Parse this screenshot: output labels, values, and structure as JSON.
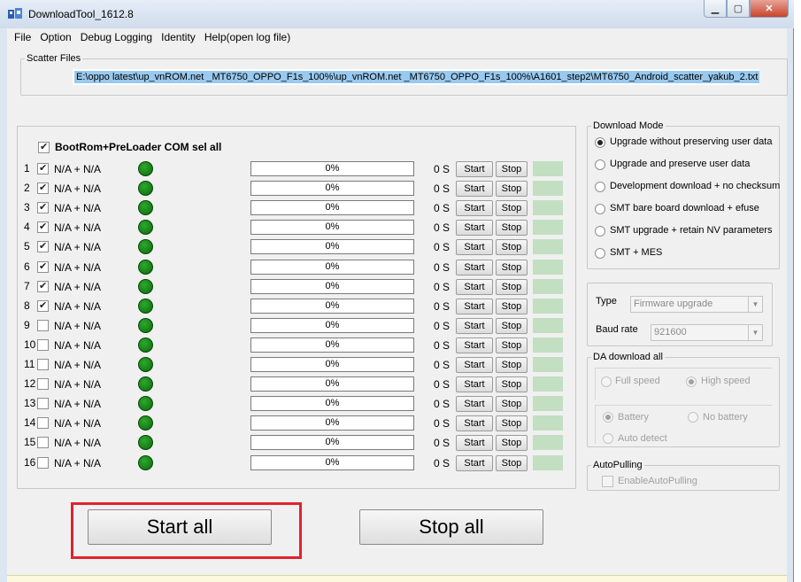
{
  "window": {
    "title": "DownloadTool_1612.8"
  },
  "menu": [
    "File",
    "Option",
    "Debug Logging",
    "Identity",
    "Help(open log file)"
  ],
  "scatter": {
    "legend": "Scatter Files",
    "path": "E:\\oppo latest\\up_vnROM.net _MT6750_OPPO_F1s_100%\\up_vnROM.net _MT6750_OPPO_F1s_100%\\A1601_step2\\MT6750_Android_scatter_yakub_2.txt"
  },
  "ports": {
    "select_all_label": "BootRom+PreLoader COM sel all",
    "select_all_checked": true,
    "rows": [
      {
        "num": "1",
        "checked": true,
        "label": "N/A + N/A",
        "progress": "0%",
        "time": "0 S",
        "start": "Start",
        "stop": "Stop"
      },
      {
        "num": "2",
        "checked": true,
        "label": "N/A + N/A",
        "progress": "0%",
        "time": "0 S",
        "start": "Start",
        "stop": "Stop"
      },
      {
        "num": "3",
        "checked": true,
        "label": "N/A + N/A",
        "progress": "0%",
        "time": "0 S",
        "start": "Start",
        "stop": "Stop"
      },
      {
        "num": "4",
        "checked": true,
        "label": "N/A + N/A",
        "progress": "0%",
        "time": "0 S",
        "start": "Start",
        "stop": "Stop"
      },
      {
        "num": "5",
        "checked": true,
        "label": "N/A + N/A",
        "progress": "0%",
        "time": "0 S",
        "start": "Start",
        "stop": "Stop"
      },
      {
        "num": "6",
        "checked": true,
        "label": "N/A + N/A",
        "progress": "0%",
        "time": "0 S",
        "start": "Start",
        "stop": "Stop"
      },
      {
        "num": "7",
        "checked": true,
        "label": "N/A + N/A",
        "progress": "0%",
        "time": "0 S",
        "start": "Start",
        "stop": "Stop"
      },
      {
        "num": "8",
        "checked": true,
        "label": "N/A + N/A",
        "progress": "0%",
        "time": "0 S",
        "start": "Start",
        "stop": "Stop"
      },
      {
        "num": "9",
        "checked": false,
        "label": "N/A + N/A",
        "progress": "0%",
        "time": "0 S",
        "start": "Start",
        "stop": "Stop"
      },
      {
        "num": "10",
        "checked": false,
        "label": "N/A + N/A",
        "progress": "0%",
        "time": "0 S",
        "start": "Start",
        "stop": "Stop"
      },
      {
        "num": "11",
        "checked": false,
        "label": "N/A + N/A",
        "progress": "0%",
        "time": "0 S",
        "start": "Start",
        "stop": "Stop"
      },
      {
        "num": "12",
        "checked": false,
        "label": "N/A + N/A",
        "progress": "0%",
        "time": "0 S",
        "start": "Start",
        "stop": "Stop"
      },
      {
        "num": "13",
        "checked": false,
        "label": "N/A + N/A",
        "progress": "0%",
        "time": "0 S",
        "start": "Start",
        "stop": "Stop"
      },
      {
        "num": "14",
        "checked": false,
        "label": "N/A + N/A",
        "progress": "0%",
        "time": "0 S",
        "start": "Start",
        "stop": "Stop"
      },
      {
        "num": "15",
        "checked": false,
        "label": "N/A + N/A",
        "progress": "0%",
        "time": "0 S",
        "start": "Start",
        "stop": "Stop"
      },
      {
        "num": "16",
        "checked": false,
        "label": "N/A + N/A",
        "progress": "0%",
        "time": "0 S",
        "start": "Start",
        "stop": "Stop"
      }
    ]
  },
  "download_mode": {
    "legend": "Download Mode",
    "options": [
      {
        "label": "Upgrade without preserving user data",
        "selected": true
      },
      {
        "label": "Upgrade and preserve user data",
        "selected": false
      },
      {
        "label": "Development download + no checksum",
        "selected": false
      },
      {
        "label": "SMT bare board download + efuse",
        "selected": false
      },
      {
        "label": "SMT upgrade + retain NV parameters",
        "selected": false
      },
      {
        "label": "SMT + MES",
        "selected": false
      }
    ]
  },
  "settings": {
    "type_label": "Type",
    "type_value": "Firmware upgrade",
    "baud_label": "Baud rate",
    "baud_value": "921600"
  },
  "da_download": {
    "legend": "DA download all",
    "full_speed": "Full speed",
    "high_speed": "High speed",
    "battery": "Battery",
    "no_battery": "No battery",
    "auto_detect": "Auto detect"
  },
  "autopulling": {
    "legend": "AutoPulling",
    "checkbox_label": "EnableAutoPulling"
  },
  "actions": {
    "start_all": "Start all",
    "stop_all": "Stop all"
  },
  "colors": {
    "highlight": "#e0232e",
    "led": "#1a8a1a",
    "status_box": "#c2dfc2"
  }
}
